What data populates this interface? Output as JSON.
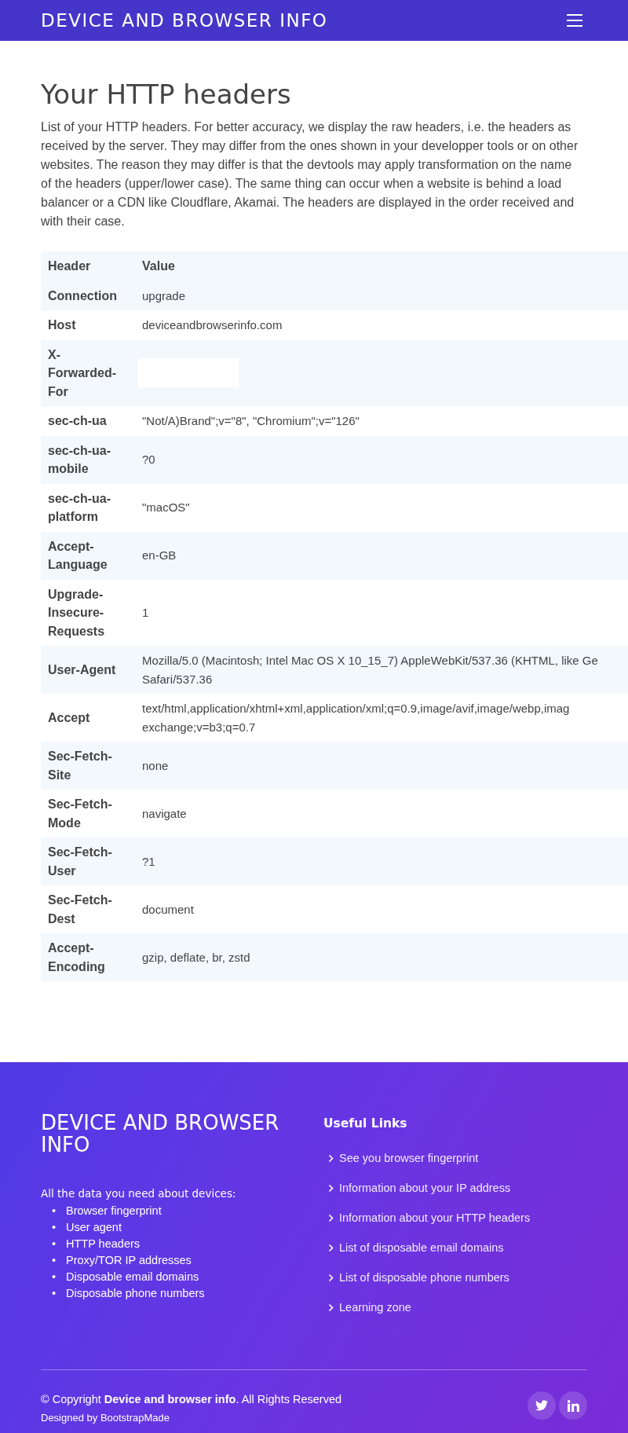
{
  "navbar": {
    "brand": "DEVICE AND BROWSER INFO"
  },
  "page": {
    "title": "Your HTTP headers",
    "intro": "List of your HTTP headers. For better accuracy, we display the raw headers, i.e. the headers as received by the server. They may differ from the ones shown in your developper tools or on other websites. The reason they may differ is that the devtools may apply transformation on the name of the headers (upper/lower case). The same thing can occur when a website is behind a load balancer or a CDN like Cloudflare, Akamai. The headers are displayed in the order received and with their case."
  },
  "table": {
    "columns": [
      "Header",
      "Value"
    ],
    "rows": [
      {
        "header": "Connection",
        "value": [
          "upgrade"
        ]
      },
      {
        "header": "Host",
        "value": [
          "deviceandbrowserinfo.com"
        ]
      },
      {
        "header": "X-Forwarded-For",
        "value": [],
        "redacted": true
      },
      {
        "header": "sec-ch-ua",
        "value": [
          "\"Not/A)Brand\";v=\"8\", \"Chromium\";v=\"126\""
        ]
      },
      {
        "header": "sec-ch-ua-mobile",
        "value": [
          "?0"
        ]
      },
      {
        "header": "sec-ch-ua-platform",
        "value": [
          "\"macOS\""
        ]
      },
      {
        "header": "Accept-Language",
        "value": [
          "en-GB"
        ]
      },
      {
        "header": "Upgrade-Insecure-Requests",
        "value": [
          "1"
        ]
      },
      {
        "header": "User-Agent",
        "value": [
          "Mozilla/5.0 (Macintosh; Intel Mac OS X 10_15_7) AppleWebKit/537.36 (KHTML, like Ge",
          "Safari/537.36"
        ]
      },
      {
        "header": "Accept",
        "value": [
          "text/html,application/xhtml+xml,application/xml;q=0.9,image/avif,image/webp,imag",
          "exchange;v=b3;q=0.7"
        ]
      },
      {
        "header": "Sec-Fetch-Site",
        "value": [
          "none"
        ]
      },
      {
        "header": "Sec-Fetch-Mode",
        "value": [
          "navigate"
        ]
      },
      {
        "header": "Sec-Fetch-User",
        "value": [
          "?1"
        ]
      },
      {
        "header": "Sec-Fetch-Dest",
        "value": [
          "document"
        ]
      },
      {
        "header": "Accept-Encoding",
        "value": [
          "gzip, deflate, br, zstd"
        ]
      }
    ]
  },
  "footer": {
    "brand": "DEVICE AND BROWSER INFO",
    "lead": "All the data you need about devices:",
    "features": [
      {
        "marker": "•",
        "text": "Browser fingerprint"
      },
      {
        "marker": "•",
        "text": "User agent"
      },
      {
        "marker": "•",
        "text": "HTTP headers"
      },
      {
        "marker": "•",
        "text": "Proxy/TOR IP addresses"
      },
      {
        "marker": "•",
        "text": "Disposable email domains"
      },
      {
        "marker": "•",
        "text": "Disposable phone numbers"
      }
    ],
    "links_title": "Useful Links",
    "links": [
      "See you browser fingerprint",
      "Information about your IP address",
      "Information about your HTTP headers",
      "List of disposable email domains",
      "List of disposable phone numbers",
      "Learning zone"
    ],
    "copyright": "© Copyright **Device and browser info**. All Rights Reserved",
    "credits": "Designed by BootstrapMade",
    "social": [
      {
        "kind": "twitter"
      },
      {
        "kind": "linkedin"
      }
    ]
  }
}
